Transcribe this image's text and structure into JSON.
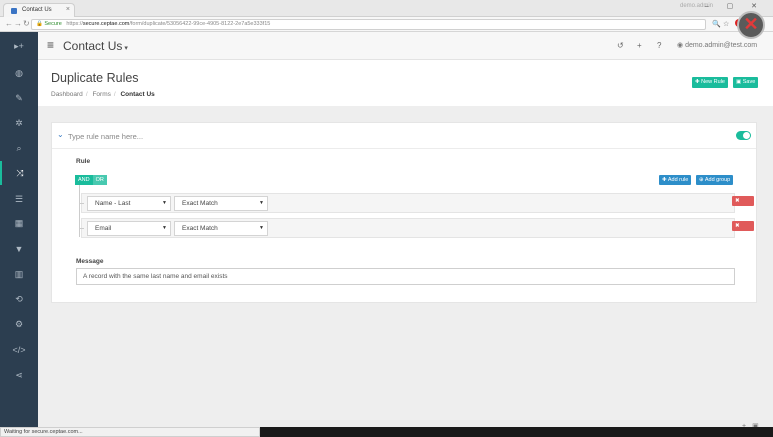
{
  "browser": {
    "tab_title": "Contact Us",
    "tab_close": "×",
    "profile": "demo.admin",
    "window_buttons": "–  ▢  ✕",
    "secure_label": "Secure",
    "url_scheme": "https://",
    "url_host": "secure.ceptae.com",
    "url_path": "/form/duplicate/53056422-99ce-4905-8122-2e7a5e333f15",
    "status": "Waiting for secure.ceptae.com..."
  },
  "app": {
    "title": "Contact Us",
    "user": "demo.admin@test.com"
  },
  "page": {
    "title": "Duplicate Rules",
    "breadcrumbs": [
      "Dashboard",
      "Forms",
      "Contact Us"
    ],
    "new_rule_label": "New Rule",
    "save_label": "Save"
  },
  "rule_card": {
    "name_placeholder": "Type rule name here...",
    "enabled": true,
    "rule_label": "Rule",
    "and_label": "AND",
    "or_label": "OR",
    "add_rule_label": "Add rule",
    "add_group_label": "Add group",
    "rules": [
      {
        "field": "Name - Last",
        "operator": "Exact Match",
        "delete_label": "Delete"
      },
      {
        "field": "Email",
        "operator": "Exact Match",
        "delete_label": "Delete"
      }
    ],
    "message_label": "Message",
    "message_value": "A record with the same last name and email exists"
  },
  "sidebar_icons": [
    "toggle-nav-icon",
    "dashboard-icon",
    "edit-icon",
    "settings-icon",
    "search-icon",
    "shuffle-icon",
    "database-icon",
    "grid-icon",
    "filter-icon",
    "chart-icon",
    "recycle-icon",
    "cogs-icon",
    "code-icon",
    "share-icon"
  ],
  "colors": {
    "sidebar": "#2c3e50",
    "accent_green": "#1abc9c",
    "accent_blue": "#2d8ec9",
    "danger": "#e05a5a"
  }
}
